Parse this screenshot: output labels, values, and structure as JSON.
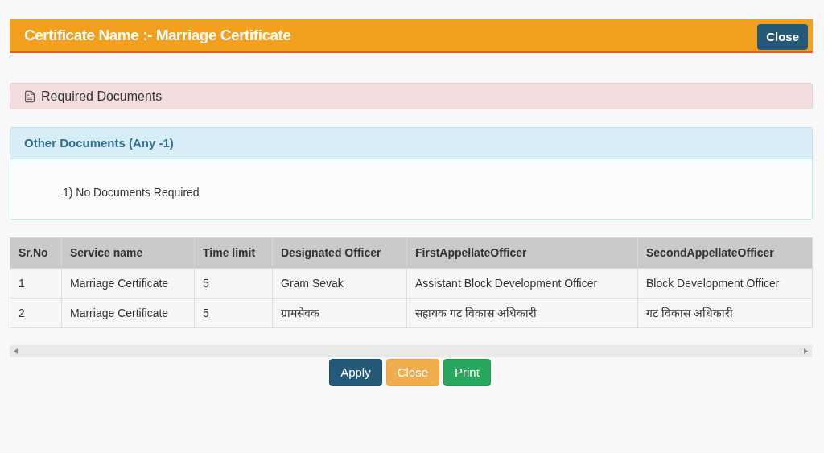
{
  "header": {
    "title": "Certificate Name :- Marriage Certificate",
    "close_button": "Close"
  },
  "required_documents": {
    "label": "Required Documents"
  },
  "other_documents": {
    "title": "Other Documents (Any -1)",
    "items": [
      "1) No Documents Required"
    ]
  },
  "table": {
    "columns": [
      "Sr.No",
      "Service name",
      "Time limit",
      "Designated Officer",
      "FirstAppellateOfficer",
      "SecondAppellateOfficer"
    ],
    "rows": [
      [
        "1",
        "Marriage Certificate",
        "5",
        "Gram Sevak",
        "Assistant Block Development Officer",
        "Block Development Officer"
      ],
      [
        "2",
        "Marriage Certificate",
        "5",
        "ग्रामसेवक",
        "सहायक गट विकास अधिकारी",
        "गट विकास अधिकारी"
      ]
    ]
  },
  "buttons": [
    {
      "label": "Apply",
      "kind": "primary"
    },
    {
      "label": "Close",
      "kind": "warning"
    },
    {
      "label": "Print",
      "kind": "success"
    }
  ]
}
